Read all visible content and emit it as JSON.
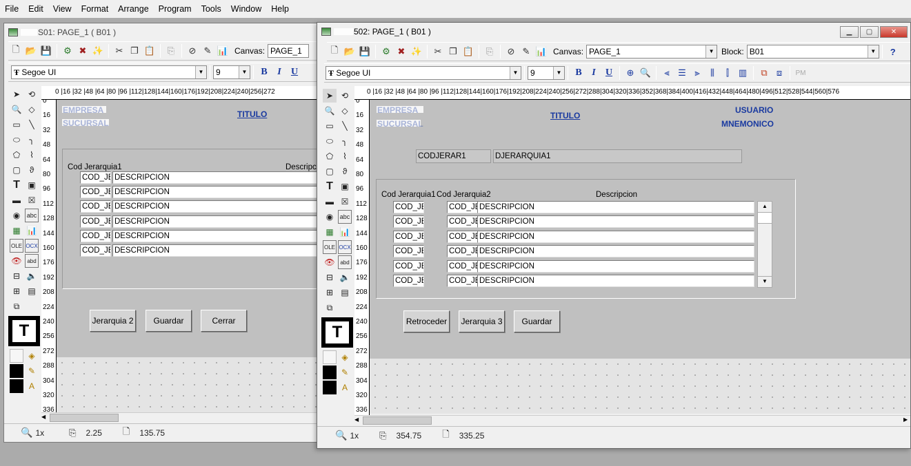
{
  "menu": [
    "File",
    "Edit",
    "View",
    "Format",
    "Arrange",
    "Program",
    "Tools",
    "Window",
    "Help"
  ],
  "w1": {
    "title": "S01: PAGE_1 ( B01 )",
    "canvas_label": "Canvas:",
    "canvas_value": "PAGE_1",
    "font_name": "Segoe UI",
    "font_size": "9",
    "ruler_h": "0 |16 |32 |48 |64 |80 |96 |112|128|144|160|176|192|208|224|240|256|272",
    "ruler_v": [
      "0",
      "16",
      "32",
      "48",
      "64",
      "80",
      "96",
      "112",
      "128",
      "144",
      "160",
      "176",
      "192",
      "208",
      "224",
      "240",
      "256",
      "272",
      "288",
      "304",
      "320",
      "336"
    ],
    "empresa": "EMPRESA",
    "sucursal": "SUCURSAL",
    "titulo": "TITULO",
    "col1": "Cod Jerarquia1",
    "col2": "Descripcion",
    "rows": [
      {
        "code": "COD_JE",
        "desc": "DESCRIPCION"
      },
      {
        "code": "COD_JE",
        "desc": "DESCRIPCION"
      },
      {
        "code": "COD_JE",
        "desc": "DESCRIPCION"
      },
      {
        "code": "COD_JE",
        "desc": "DESCRIPCION"
      },
      {
        "code": "COD_JE",
        "desc": "DESCRIPCION"
      },
      {
        "code": "COD_JE",
        "desc": "DESCRIPCION"
      }
    ],
    "btn_jer": "Jerarquia 2",
    "btn_guardar": "Guardar",
    "btn_cerrar": "Cerrar",
    "zoom": "1x",
    "coord_x": "2.25",
    "coord_y": "135.75"
  },
  "w2": {
    "title": "502: PAGE_1 ( B01 )",
    "canvas_label": "Canvas:",
    "canvas_value": "PAGE_1",
    "block_label": "Block:",
    "block_value": "B01",
    "font_name": "Segoe UI",
    "font_size": "9",
    "ruler_h": "0   |16 |32 |48 |64 |80 |96 |112|128|144|160|176|192|208|224|240|256|272|288|304|320|336|352|368|384|400|416|432|448|464|480|496|512|528|544|560|576",
    "ruler_v": [
      "0",
      "16",
      "32",
      "48",
      "64",
      "80",
      "96",
      "112",
      "128",
      "144",
      "160",
      "176",
      "192",
      "208",
      "224",
      "240",
      "256",
      "272",
      "288",
      "304",
      "320",
      "336"
    ],
    "empresa": "EMPRESA",
    "sucursal": "SUCURSAL",
    "titulo": "TITULO",
    "usuario": "USUARIO",
    "mnemonico": "MNEMONICO",
    "codjerar": "CODJERAR1",
    "djerarquia": "DJERARQUIA1",
    "col1": "Cod Jerarquia1",
    "col2": "Cod Jerarquia2",
    "col3": "Descripcion",
    "rows": [
      {
        "code1": "COD_JE",
        "code2": "COD_JE",
        "desc": "DESCRIPCION"
      },
      {
        "code1": "COD_JE",
        "code2": "COD_JE",
        "desc": "DESCRIPCION"
      },
      {
        "code1": "COD_JE",
        "code2": "COD_JE",
        "desc": "DESCRIPCION"
      },
      {
        "code1": "COD_JE",
        "code2": "COD_JE",
        "desc": "DESCRIPCION"
      },
      {
        "code1": "COD_JE",
        "code2": "COD_JE",
        "desc": "DESCRIPCION"
      },
      {
        "code1": "COD_JE",
        "code2": "COD_JE",
        "desc": "DESCRIPCION"
      }
    ],
    "btn_retroceder": "Retroceder",
    "btn_jer": "Jerarquia 3",
    "btn_guardar": "Guardar",
    "zoom": "1x",
    "coord_x": "354.75",
    "coord_y": "335.25"
  }
}
